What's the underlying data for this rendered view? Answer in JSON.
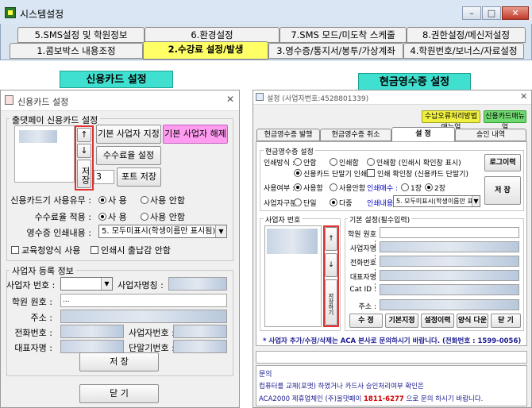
{
  "main_window": {
    "title": "시스템설정",
    "minimize": "–",
    "maximize": "□",
    "close": "✕",
    "tabs_row1": [
      "5.SMS설정 및 학원정보",
      "6.환경설정",
      "7.SMS 모드/미도착 스케줄",
      "8.권한설정/메신저설정"
    ],
    "tabs_row2": [
      "1.콤보박스 내용조정",
      "2.수강료 설정/발생",
      "3.영수증/통지서/봉투/가상계좌",
      "4.학원번호/보너스/자료설정"
    ]
  },
  "section_labels": {
    "credit": "신용카드 설정",
    "cash": "현금영수증 설정"
  },
  "credit_dialog": {
    "title": "신용카드 설정",
    "close": "✕",
    "group1": "출댓페이 신용카드 설정",
    "arrow_up": "↑",
    "arrow_down": "↓",
    "save_vertical": "저장",
    "btn_default_set": "기본 사업자 지정",
    "btn_default_unset": "기본 사업자 해제",
    "btn_fee": "수수료율 설정",
    "port_value": "3",
    "btn_port": "포트 저장",
    "reader_label": "신용카드기 사용유무 :",
    "reader_on": "사 용",
    "reader_off": "사용 안함",
    "fee_label": "수수료율 적용 :",
    "fee_on": "사 용",
    "fee_off": "사용 안함",
    "receipt_label": "영수증 인쇄내용 :",
    "receipt_value": "5. 모두미표시(학생이름만 표시됨)",
    "chk_edu": "교육청양식 사용",
    "chk_print": "인쇄시 출납감 안함",
    "group2": "사업자 등록 정보",
    "biz_no_label": "사업자 번호 :",
    "biz_name_label": "사업자명칭 :",
    "academy_no_label": "학원 원호 :",
    "academy_no_value": "...",
    "address_label": "주소 :",
    "phone_label": "전화번호 :",
    "biz_no2_label": "사업자번호 :",
    "rep_label": "대표자명 :",
    "terminal_label": "단말기번호 :",
    "btn_save": "저 장",
    "btn_close": "닫 기"
  },
  "cash_dialog": {
    "title": "설정 (사업자번호:4528801339)",
    "close": "✕",
    "btn_manual1": "수납오류처리방법매뉴얼",
    "btn_manual2": "신용카드매뉴얼",
    "tabs": [
      "현금영수증 발행",
      "현금영수증 취소",
      "설 정",
      "승인 내역"
    ],
    "group1": "현금영수증 설정",
    "print_label": "인쇄방식 :",
    "opt_none": "안함",
    "opt_print": "인쇄함",
    "opt_print_confirm": "인쇄함 (인쇄시 확인창 표시)",
    "opt_card_print": "신용카드 단말기 인쇄",
    "opt_print_confirm2": "인쇄 확인창 (신용카드 단말기)",
    "use_label": "사용여부 :",
    "use_on": "사용함",
    "use_off": "사용안함",
    "copies_label": "인쇄매수 :",
    "copy1": "1장",
    "copy2": "2장",
    "biz_label": "사업자구분 :",
    "biz_single": "단일",
    "biz_multi": "다중",
    "content_label": "인쇄내용 :",
    "content_value": "5. 모두미표시(학생이름만 표시됨)",
    "btn_log": "로그이력",
    "btn_save": "저 장",
    "group2": "사업자 번호",
    "group3": "기본 설정(필수입력)",
    "f_academy": "학원 원호 :",
    "f_bizname": "사업자명 :",
    "f_phone": "전화번호 :",
    "f_rep": "대표자명 :",
    "f_catid": "Cat ID :",
    "f_addr": "주소 :",
    "arrow_up": "↑",
    "arrow_down": "↓",
    "save_vertical": "저장하기",
    "btn_edit": "수 정",
    "btn_basic": "기본지정",
    "btn_history": "설정이력",
    "btn_form": "양식 다운",
    "btn_close": "닫 기",
    "notice": "* 사업자 추가/수정/삭제는 ACA 본사로 문의하시기 바랍니다. (전화번호 : 1599-0056)",
    "info_title": "문의",
    "info1": "컴퓨터를 교체(포맷) 하였거나 카드사 승인처리여부 확인은",
    "info2_pre": "ACA2000 제휴업체인 (주)올댓페이 ",
    "info2_phone": "1811-6277",
    "info2_post": " 으로 문의 하시기 바랍니다."
  },
  "colors": {
    "accent_yellow": "#ffff66",
    "section_label": "#40e0d0",
    "pink_button": "#ff9cf0",
    "highlight_red": "#e03030"
  }
}
